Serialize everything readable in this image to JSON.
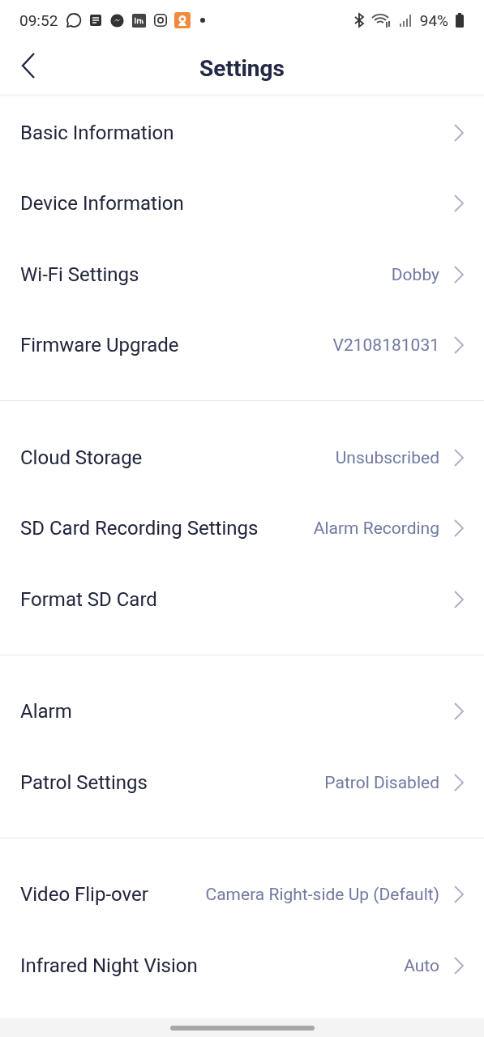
{
  "status_bar": {
    "time": "09:52",
    "battery": "94%"
  },
  "header": {
    "title": "Settings"
  },
  "groups": [
    {
      "items": [
        {
          "label": "Basic Information"
        },
        {
          "label": "Device Information"
        },
        {
          "label": "Wi-Fi Settings",
          "value": "Dobby"
        },
        {
          "label": "Firmware Upgrade",
          "value": "V2108181031"
        }
      ]
    },
    {
      "items": [
        {
          "label": "Cloud Storage",
          "value": "Unsubscribed"
        },
        {
          "label": "SD Card Recording Settings",
          "value": "Alarm Recording"
        },
        {
          "label": "Format SD Card"
        }
      ]
    },
    {
      "items": [
        {
          "label": "Alarm"
        },
        {
          "label": "Patrol Settings",
          "value": "Patrol Disabled"
        }
      ]
    },
    {
      "items": [
        {
          "label": "Video Flip-over",
          "value": "Camera Right-side Up (Default)"
        },
        {
          "label": "Infrared Night Vision",
          "value": "Auto"
        }
      ]
    }
  ]
}
